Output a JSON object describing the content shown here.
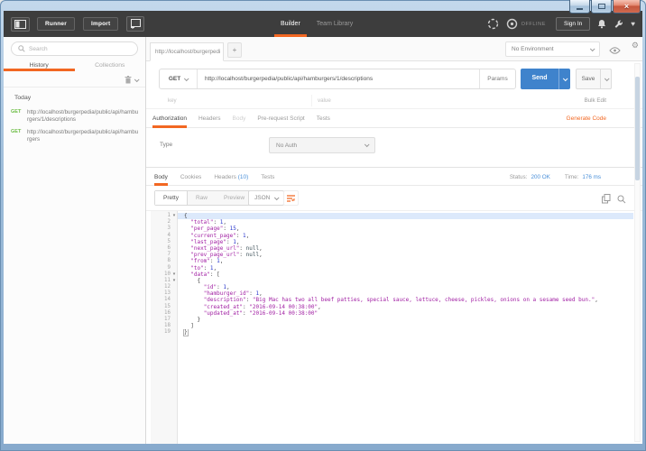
{
  "accent": "#f26722",
  "colors": {
    "send_button": "#3f83cc",
    "get_method_green": "#6dbd45",
    "status_blue": "#4a90d9",
    "json_key": "#a11fa3",
    "json_string": "#a11fa3",
    "json_number": "#2836cc",
    "toolbar_bg": "#3d3d3d"
  },
  "icons": {
    "fold": "▾",
    "close": "×",
    "plus": "+",
    "gear": "⚙",
    "heart": "♥",
    "sidebar_toggle": "svg-panel",
    "new_window": "svg-window-plus",
    "interceptor": "svg-dashed-ring",
    "sync": "svg-ring-dot",
    "bell": "svg-bell",
    "wrench": "svg-wrench",
    "search": "svg-magnifier",
    "trash": "svg-trash",
    "eye": "svg-eye",
    "copy": "svg-copy",
    "wrap_lines": "svg-wrap"
  },
  "topbar": {
    "runner_label": "Runner",
    "import_label": "Import",
    "nav": [
      {
        "label": "Builder",
        "active": true
      },
      {
        "label": "Team Library",
        "active": false
      }
    ],
    "offline_label": "OFFLINE",
    "sign_in_label": "Sign In"
  },
  "sidebar": {
    "search_placeholder": "Search",
    "tabs": [
      {
        "label": "History",
        "active": true
      },
      {
        "label": "Collections",
        "active": false
      }
    ],
    "group_label": "Today",
    "items": [
      {
        "method": "GET",
        "url": "http://localhost/burgerpedia/public/api/hamburgers/1/descriptions"
      },
      {
        "method": "GET",
        "url": "http://localhost/burgerpedia/public/api/hamburgers"
      }
    ]
  },
  "tabstrip": {
    "tab_label": "http://localhost/burgerpedi",
    "new_tab_label": "+",
    "environment": "No Environment"
  },
  "request": {
    "method": "GET",
    "url": "http://localhost/burgerpedia/public/api/hamburgers/1/descriptions",
    "params_label": "Params",
    "send_label": "Send",
    "save_label": "Save",
    "key_placeholder": "key",
    "value_placeholder": "value",
    "bulk_edit_label": "Bulk Edit",
    "tabs": [
      {
        "label": "Authorization",
        "state": "active"
      },
      {
        "label": "Headers",
        "state": "normal"
      },
      {
        "label": "Body",
        "state": "disabled"
      },
      {
        "label": "Pre-request Script",
        "state": "normal"
      },
      {
        "label": "Tests",
        "state": "normal"
      }
    ],
    "generate_code_label": "Generate Code",
    "type_label": "Type",
    "auth_type": "No Auth"
  },
  "response": {
    "tabs": [
      {
        "label": "Body",
        "state": "active"
      },
      {
        "label": "Cookies",
        "state": "normal"
      },
      {
        "label": "Headers",
        "count": "(10)",
        "state": "normal"
      },
      {
        "label": "Tests",
        "state": "normal"
      }
    ],
    "status_label": "Status:",
    "status_value": "200 OK",
    "time_label": "Time:",
    "time_value": "176 ms",
    "view_modes": [
      {
        "label": "Pretty",
        "active": true
      },
      {
        "label": "Raw",
        "active": false
      },
      {
        "label": "Preview",
        "active": false
      }
    ],
    "format": "JSON",
    "body_lines": [
      {
        "fold": true,
        "tokens": [
          [
            "p",
            "{"
          ]
        ]
      },
      {
        "tokens": [
          [
            "w",
            "  "
          ],
          [
            "k",
            "\"total\""
          ],
          [
            "p",
            ": "
          ],
          [
            "n",
            "1"
          ],
          [
            "p",
            ","
          ]
        ]
      },
      {
        "tokens": [
          [
            "w",
            "  "
          ],
          [
            "k",
            "\"per_page\""
          ],
          [
            "p",
            ": "
          ],
          [
            "n",
            "15"
          ],
          [
            "p",
            ","
          ]
        ]
      },
      {
        "tokens": [
          [
            "w",
            "  "
          ],
          [
            "k",
            "\"current_page\""
          ],
          [
            "p",
            ": "
          ],
          [
            "n",
            "1"
          ],
          [
            "p",
            ","
          ]
        ]
      },
      {
        "tokens": [
          [
            "w",
            "  "
          ],
          [
            "k",
            "\"last_page\""
          ],
          [
            "p",
            ": "
          ],
          [
            "n",
            "1"
          ],
          [
            "p",
            ","
          ]
        ]
      },
      {
        "tokens": [
          [
            "w",
            "  "
          ],
          [
            "k",
            "\"next_page_url\""
          ],
          [
            "p",
            ": "
          ],
          [
            "u",
            "null"
          ],
          [
            "p",
            ","
          ]
        ]
      },
      {
        "tokens": [
          [
            "w",
            "  "
          ],
          [
            "k",
            "\"prev_page_url\""
          ],
          [
            "p",
            ": "
          ],
          [
            "u",
            "null"
          ],
          [
            "p",
            ","
          ]
        ]
      },
      {
        "tokens": [
          [
            "w",
            "  "
          ],
          [
            "k",
            "\"from\""
          ],
          [
            "p",
            ": "
          ],
          [
            "n",
            "1"
          ],
          [
            "p",
            ","
          ]
        ]
      },
      {
        "tokens": [
          [
            "w",
            "  "
          ],
          [
            "k",
            "\"to\""
          ],
          [
            "p",
            ": "
          ],
          [
            "n",
            "1"
          ],
          [
            "p",
            ","
          ]
        ]
      },
      {
        "fold": true,
        "tokens": [
          [
            "w",
            "  "
          ],
          [
            "k",
            "\"data\""
          ],
          [
            "p",
            ": ["
          ]
        ]
      },
      {
        "fold": true,
        "tokens": [
          [
            "w",
            "    "
          ],
          [
            "p",
            "{"
          ]
        ]
      },
      {
        "tokens": [
          [
            "w",
            "      "
          ],
          [
            "k",
            "\"id\""
          ],
          [
            "p",
            ": "
          ],
          [
            "n",
            "1"
          ],
          [
            "p",
            ","
          ]
        ]
      },
      {
        "tokens": [
          [
            "w",
            "      "
          ],
          [
            "k",
            "\"hamburger_id\""
          ],
          [
            "p",
            ": "
          ],
          [
            "n",
            "1"
          ],
          [
            "p",
            ","
          ]
        ]
      },
      {
        "tokens": [
          [
            "w",
            "      "
          ],
          [
            "k",
            "\"description\""
          ],
          [
            "p",
            ": "
          ],
          [
            "s",
            "\"Big Mac has two all beef patties, special sauce, lettuce, cheese, pickles, onions on a sesame seed bun.\""
          ],
          [
            "p",
            ","
          ]
        ]
      },
      {
        "tokens": [
          [
            "w",
            "      "
          ],
          [
            "k",
            "\"created_at\""
          ],
          [
            "p",
            ": "
          ],
          [
            "s",
            "\"2016-09-14 00:38:00\""
          ],
          [
            "p",
            ","
          ]
        ]
      },
      {
        "tokens": [
          [
            "w",
            "      "
          ],
          [
            "k",
            "\"updated_at\""
          ],
          [
            "p",
            ": "
          ],
          [
            "s",
            "\"2016-09-14 00:38:00\""
          ]
        ]
      },
      {
        "tokens": [
          [
            "w",
            "    "
          ],
          [
            "p",
            "}"
          ]
        ]
      },
      {
        "tokens": [
          [
            "w",
            "  "
          ],
          [
            "p",
            "]"
          ]
        ]
      },
      {
        "tokens": [
          [
            "m",
            "}"
          ]
        ]
      }
    ]
  }
}
